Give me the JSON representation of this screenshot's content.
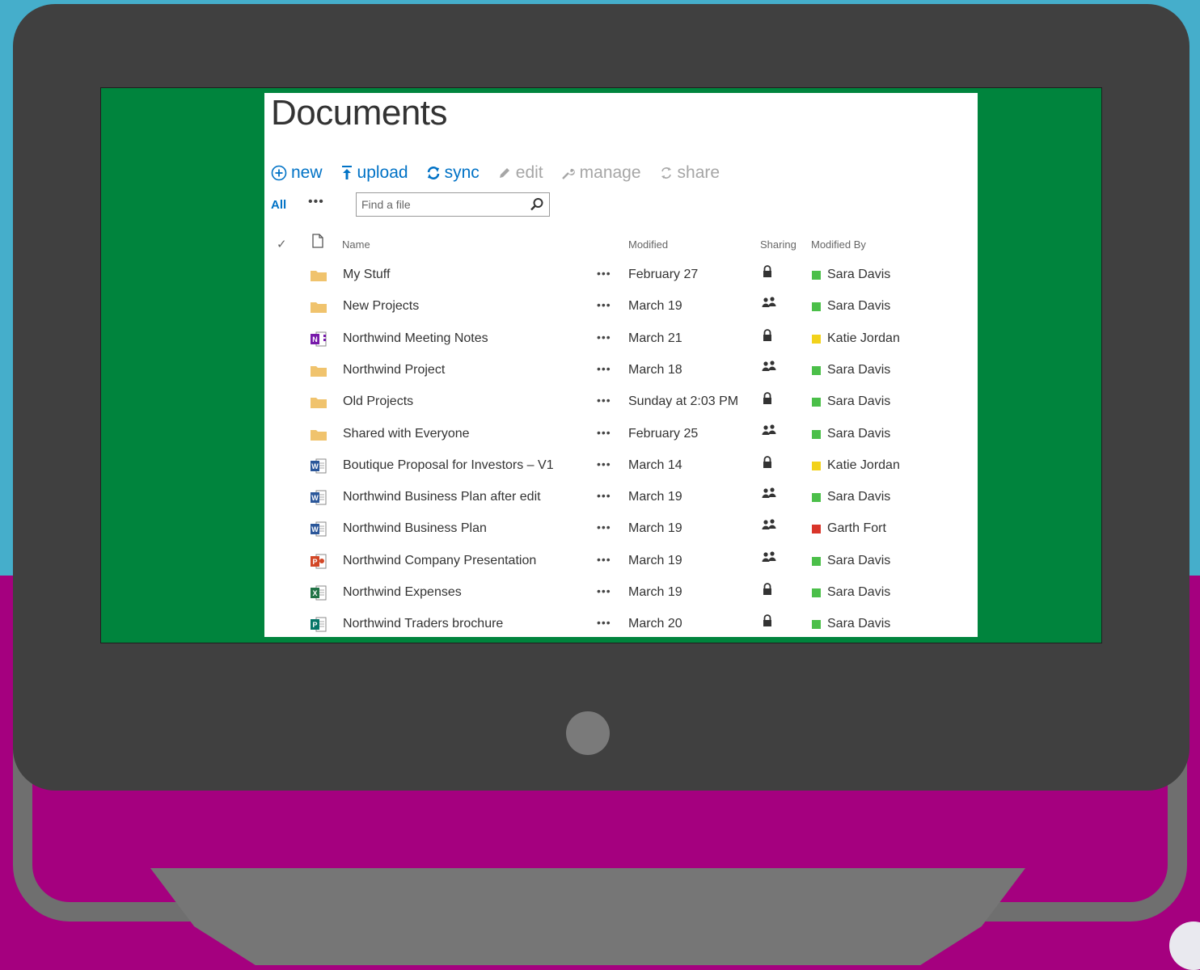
{
  "library": {
    "title": "Documents",
    "toolbar": [
      {
        "label": "new",
        "icon": "plus-circle-icon",
        "state": "active"
      },
      {
        "label": "upload",
        "icon": "upload-icon",
        "state": "active"
      },
      {
        "label": "sync",
        "icon": "sync-icon",
        "state": "active"
      },
      {
        "label": "edit",
        "icon": "pencil-icon",
        "state": "disabled"
      },
      {
        "label": "manage",
        "icon": "wrench-icon",
        "state": "disabled"
      },
      {
        "label": "share",
        "icon": "share-icon",
        "state": "disabled"
      }
    ],
    "view_all_label": "All",
    "more_views_label": "•••",
    "search": {
      "placeholder": "Find a file",
      "value": ""
    },
    "columns": {
      "name": "Name",
      "modified": "Modified",
      "sharing": "Sharing",
      "modified_by": "Modified By"
    },
    "row_menu_label": "•••",
    "files": [
      {
        "name": "My Stuff",
        "type": "folder",
        "modified": "February 27",
        "sharing": "private",
        "modified_by": "Sara Davis",
        "status_color": "#4bbf49"
      },
      {
        "name": "New Projects",
        "type": "folder",
        "modified": "March 19",
        "sharing": "shared",
        "modified_by": "Sara Davis",
        "status_color": "#4bbf49"
      },
      {
        "name": "Northwind Meeting Notes",
        "type": "onenote",
        "modified": "March 21",
        "sharing": "private",
        "modified_by": "Katie Jordan",
        "status_color": "#f2d21b"
      },
      {
        "name": "Northwind Project",
        "type": "folder",
        "modified": "March 18",
        "sharing": "shared",
        "modified_by": "Sara Davis",
        "status_color": "#4bbf49"
      },
      {
        "name": "Old Projects",
        "type": "folder",
        "modified": "Sunday at 2:03 PM",
        "sharing": "private",
        "modified_by": "Sara Davis",
        "status_color": "#4bbf49"
      },
      {
        "name": "Shared with Everyone",
        "type": "folder",
        "modified": "February 25",
        "sharing": "shared",
        "modified_by": "Sara Davis",
        "status_color": "#4bbf49"
      },
      {
        "name": "Boutique Proposal for Investors – V1",
        "type": "word",
        "modified": "March 14",
        "sharing": "private",
        "modified_by": "Katie Jordan",
        "status_color": "#f2d21b"
      },
      {
        "name": "Northwind Business Plan after edit",
        "type": "word",
        "modified": "March 19",
        "sharing": "shared",
        "modified_by": "Sara Davis",
        "status_color": "#4bbf49"
      },
      {
        "name": "Northwind Business Plan",
        "type": "word",
        "modified": "March 19",
        "sharing": "shared",
        "modified_by": "Garth Fort",
        "status_color": "#d9352a"
      },
      {
        "name": "Northwind Company Presentation",
        "type": "powerpoint",
        "modified": "March 19",
        "sharing": "shared",
        "modified_by": "Sara Davis",
        "status_color": "#4bbf49"
      },
      {
        "name": "Northwind Expenses",
        "type": "excel",
        "modified": "March 19",
        "sharing": "private",
        "modified_by": "Sara Davis",
        "status_color": "#4bbf49"
      },
      {
        "name": "Northwind Traders brochure",
        "type": "publisher",
        "modified": "March 20",
        "sharing": "private",
        "modified_by": "Sara Davis",
        "status_color": "#4bbf49"
      }
    ]
  },
  "colors": {
    "background_top": "#45aecb",
    "background_bottom": "#a5007f",
    "monitor_bezel": "#404040",
    "screen": "#00843d",
    "accent": "#0072c6",
    "disabled": "#a6a6a6",
    "folder": "#f0c36d"
  }
}
